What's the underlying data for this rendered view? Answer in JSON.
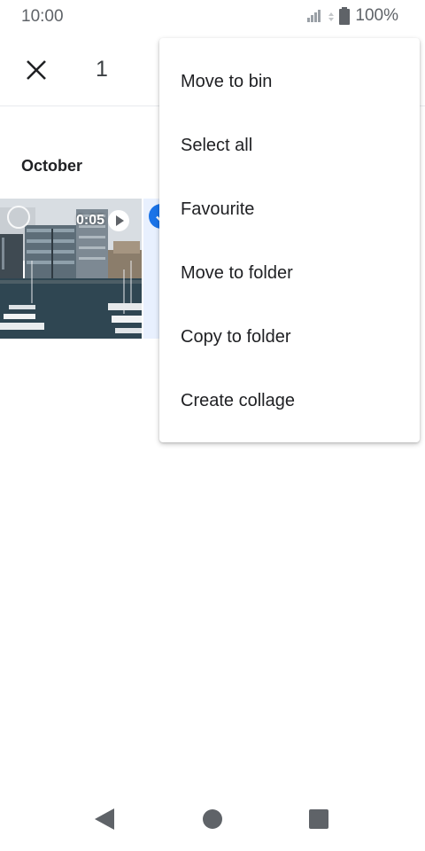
{
  "status_bar": {
    "time": "10:00",
    "battery_text": "100%",
    "icons": [
      "signal-icon",
      "data-activity-icon",
      "battery-icon"
    ]
  },
  "app_bar": {
    "close_icon": "close-icon",
    "selection_count": "1"
  },
  "content": {
    "section_date": "October",
    "thumbnails": [
      {
        "type": "video",
        "duration": "0:05",
        "selected": false,
        "icons": [
          "select-circle-icon",
          "play-icon"
        ]
      },
      {
        "type": "photo",
        "selected": true,
        "icons": [
          "check-circle-icon"
        ]
      }
    ]
  },
  "menu": {
    "items": [
      {
        "label": "Move to bin"
      },
      {
        "label": "Select all"
      },
      {
        "label": "Favourite"
      },
      {
        "label": "Move to folder"
      },
      {
        "label": "Copy to folder"
      },
      {
        "label": "Create collage"
      }
    ]
  },
  "nav_bar": {
    "icons": [
      "back-icon",
      "home-icon",
      "recents-icon"
    ]
  },
  "colors": {
    "accent": "#1a73e8",
    "text_primary": "#202124",
    "icon_grey": "#5f6368"
  }
}
